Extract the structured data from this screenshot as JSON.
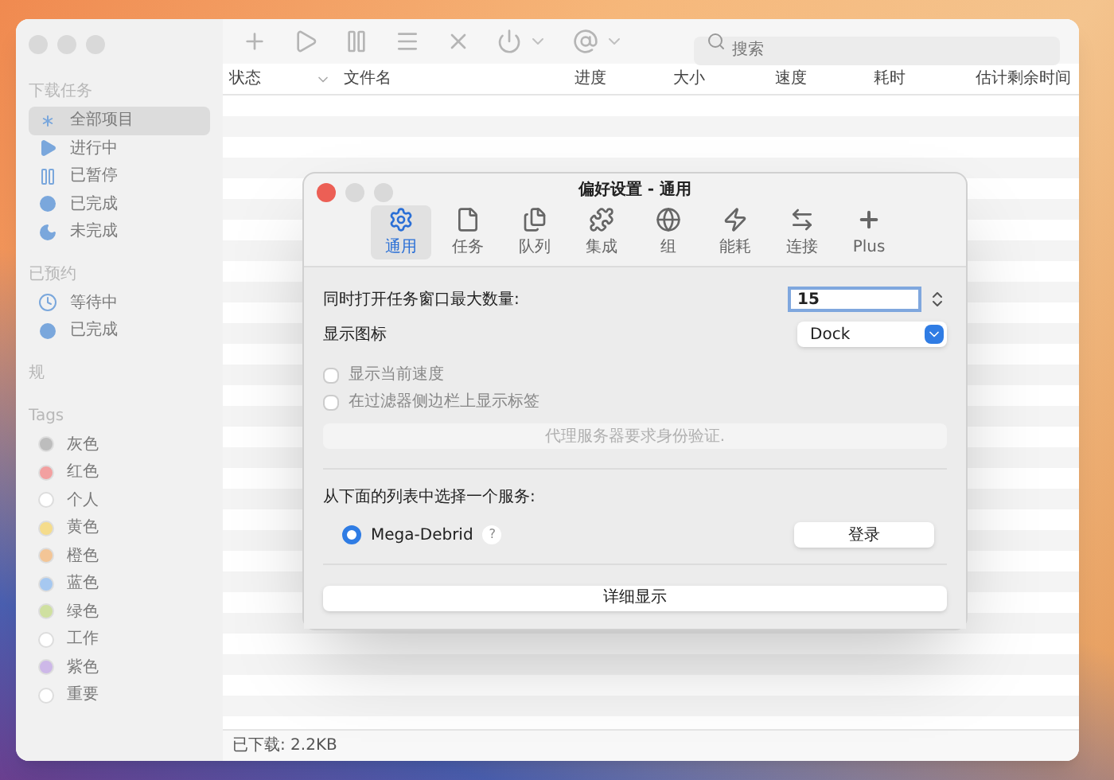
{
  "toolbar": {
    "search": {
      "placeholder": "搜索"
    }
  },
  "sidebar": {
    "sections": [
      {
        "title": "下载任务",
        "items": [
          {
            "label": "全部项目",
            "kind": "all",
            "selected": true
          },
          {
            "label": "进行中",
            "kind": "play",
            "selected": false
          },
          {
            "label": "已暂停",
            "kind": "pause",
            "selected": false
          },
          {
            "label": "已完成",
            "kind": "done",
            "selected": false
          },
          {
            "label": "未完成",
            "kind": "moon",
            "selected": false
          }
        ]
      },
      {
        "title": "已预约",
        "items": [
          {
            "label": "等待中",
            "kind": "clock",
            "selected": false
          },
          {
            "label": "已完成",
            "kind": "done",
            "selected": false
          }
        ]
      },
      {
        "title": "规"
      },
      {
        "title": "Tags",
        "items": [
          {
            "label": "灰色",
            "color": "#bdbdbd",
            "selected": false
          },
          {
            "label": "红色",
            "color": "#f2a0a0",
            "selected": false
          },
          {
            "label": "个人",
            "color": "#ffffff",
            "selected": false
          },
          {
            "label": "黄色",
            "color": "#f5dc8c",
            "selected": false
          },
          {
            "label": "橙色",
            "color": "#f3c596",
            "selected": false
          },
          {
            "label": "蓝色",
            "color": "#a6c8f0",
            "selected": false
          },
          {
            "label": "绿色",
            "color": "#cfe0a0",
            "selected": false
          },
          {
            "label": "工作",
            "color": "#ffffff",
            "selected": false
          },
          {
            "label": "紫色",
            "color": "#cdb8e8",
            "selected": false
          },
          {
            "label": "重要",
            "color": "#ffffff",
            "selected": false
          }
        ]
      }
    ]
  },
  "table": {
    "columns": [
      "状态",
      "文件名",
      "进度",
      "大小",
      "速度",
      "耗时",
      "估计剩余时间"
    ]
  },
  "status_bar": "已下载: 2.2KB",
  "dialog": {
    "title": "偏好设置 - 通用",
    "tabs": [
      {
        "label": "通用",
        "kind": "gear",
        "selected": true
      },
      {
        "label": "任务",
        "kind": "doc",
        "selected": false
      },
      {
        "label": "队列",
        "kind": "docs",
        "selected": false
      },
      {
        "label": "集成",
        "kind": "puzzle",
        "selected": false
      },
      {
        "label": "组",
        "kind": "group",
        "selected": false
      },
      {
        "label": "能耗",
        "kind": "bolt",
        "selected": false
      },
      {
        "label": "连接",
        "kind": "arrows",
        "selected": false
      },
      {
        "label": "Plus",
        "kind": "plus",
        "selected": false
      }
    ],
    "max_tasks": {
      "label": "同时打开任务窗口最大数量:",
      "value": "15"
    },
    "show_icon": {
      "label": "显示图标",
      "value": "Dock"
    },
    "checkboxes": [
      {
        "label": "显示当前速度",
        "checked": false
      },
      {
        "label": "在过滤器侧边栏上显示标签",
        "checked": false
      }
    ],
    "proxy_button": {
      "label": "代理服务器要求身份验证.",
      "disabled": true
    },
    "service_prompt": "从下面的列表中选择一个服务:",
    "services": [
      {
        "label": "Mega-Debrid",
        "help": "?",
        "selected": true
      }
    ],
    "login_button": "登录",
    "details_button": "详细显示"
  }
}
